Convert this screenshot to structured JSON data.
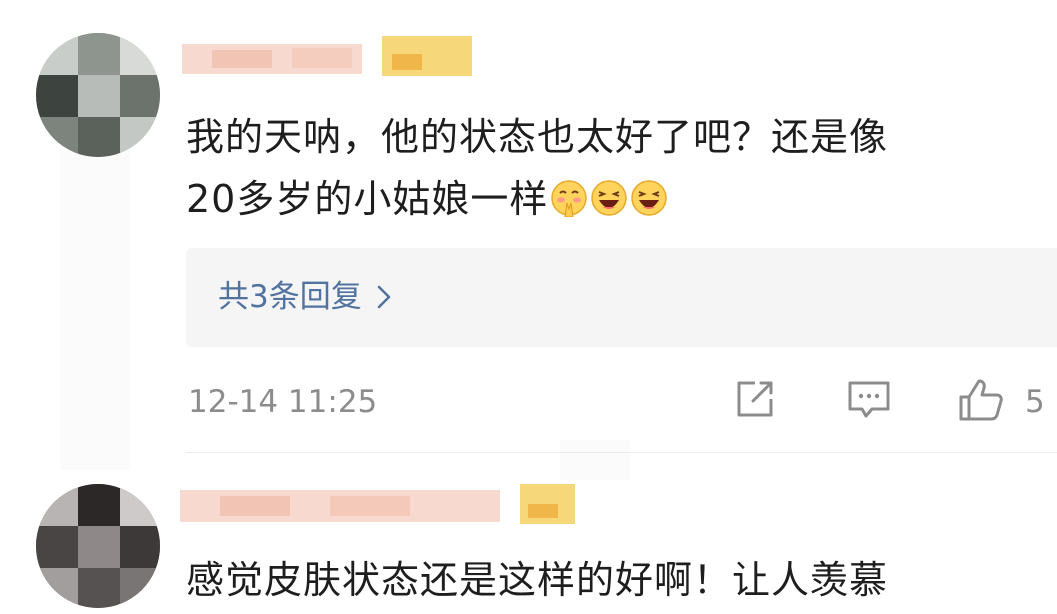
{
  "comments": [
    {
      "text_line1": "我的天呐，他的状态也太好了吧？还是像",
      "text_line2": "20多岁的小姑娘一样",
      "emojis": [
        "pray-blush-icon",
        "laughing-icon",
        "laughing-icon"
      ],
      "reply_link": "共3条回复",
      "timestamp": "12-14 11:25",
      "like_count": "5"
    },
    {
      "text_line1": "感觉皮肤状态还是这样的好啊！让人羡慕"
    }
  ],
  "colors": {
    "text": "#1e1e1e",
    "meta": "#8c8c8c",
    "link": "#51739f",
    "reply_bg": "#f5f5f5"
  }
}
